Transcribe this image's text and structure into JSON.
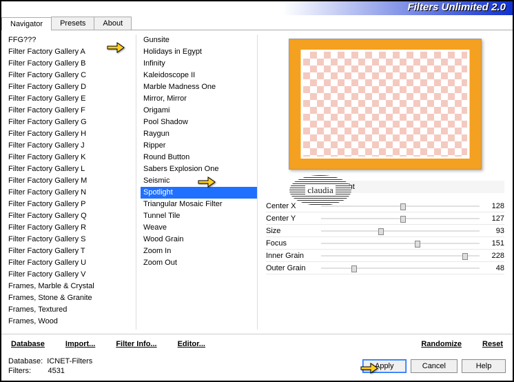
{
  "header": {
    "title": "Filters Unlimited 2.0"
  },
  "tabs": [
    "Navigator",
    "Presets",
    "About"
  ],
  "active_tab": 0,
  "categories": [
    "FFG???",
    "Filter Factory Gallery A",
    "Filter Factory Gallery B",
    "Filter Factory Gallery C",
    "Filter Factory Gallery D",
    "Filter Factory Gallery E",
    "Filter Factory Gallery F",
    "Filter Factory Gallery G",
    "Filter Factory Gallery H",
    "Filter Factory Gallery J",
    "Filter Factory Gallery K",
    "Filter Factory Gallery L",
    "Filter Factory Gallery M",
    "Filter Factory Gallery N",
    "Filter Factory Gallery P",
    "Filter Factory Gallery Q",
    "Filter Factory Gallery R",
    "Filter Factory Gallery S",
    "Filter Factory Gallery T",
    "Filter Factory Gallery U",
    "Filter Factory Gallery V",
    "Frames, Marble & Crystal",
    "Frames, Stone & Granite",
    "Frames, Textured",
    "Frames, Wood"
  ],
  "selected_category_index": 1,
  "filters": [
    "Gunsite",
    "Holidays in Egypt",
    "Infinity",
    "Kaleidoscope II",
    "Marble Madness One",
    "Mirror, Mirror",
    "Origami",
    "Pool Shadow",
    "Raygun",
    "Ripper",
    "Round Button",
    "Sabers Explosion One",
    "Seismic",
    "Spotlight",
    "Triangular Mosaic Filter",
    "Tunnel Tile",
    "Weave",
    "Wood Grain",
    "Zoom In",
    "Zoom Out"
  ],
  "selected_filter_index": 13,
  "current_filter_name": "Spotlight",
  "badge_text": "claudia",
  "params": [
    {
      "name": "Center X",
      "value": 128,
      "pct": 50
    },
    {
      "name": "Center Y",
      "value": 127,
      "pct": 50
    },
    {
      "name": "Size",
      "value": 93,
      "pct": 36
    },
    {
      "name": "Focus",
      "value": 151,
      "pct": 59
    },
    {
      "name": "Inner Grain",
      "value": 228,
      "pct": 89
    },
    {
      "name": "Outer Grain",
      "value": 48,
      "pct": 19
    }
  ],
  "toolbar": {
    "database": "Database",
    "import": "Import...",
    "filter_info": "Filter Info...",
    "editor": "Editor...",
    "randomize": "Randomize",
    "reset": "Reset"
  },
  "status": {
    "db_label": "Database:",
    "db_value": "ICNET-Filters",
    "filters_label": "Filters:",
    "filters_count": "4531"
  },
  "dialog": {
    "apply": "Apply",
    "cancel": "Cancel",
    "help": "Help"
  }
}
